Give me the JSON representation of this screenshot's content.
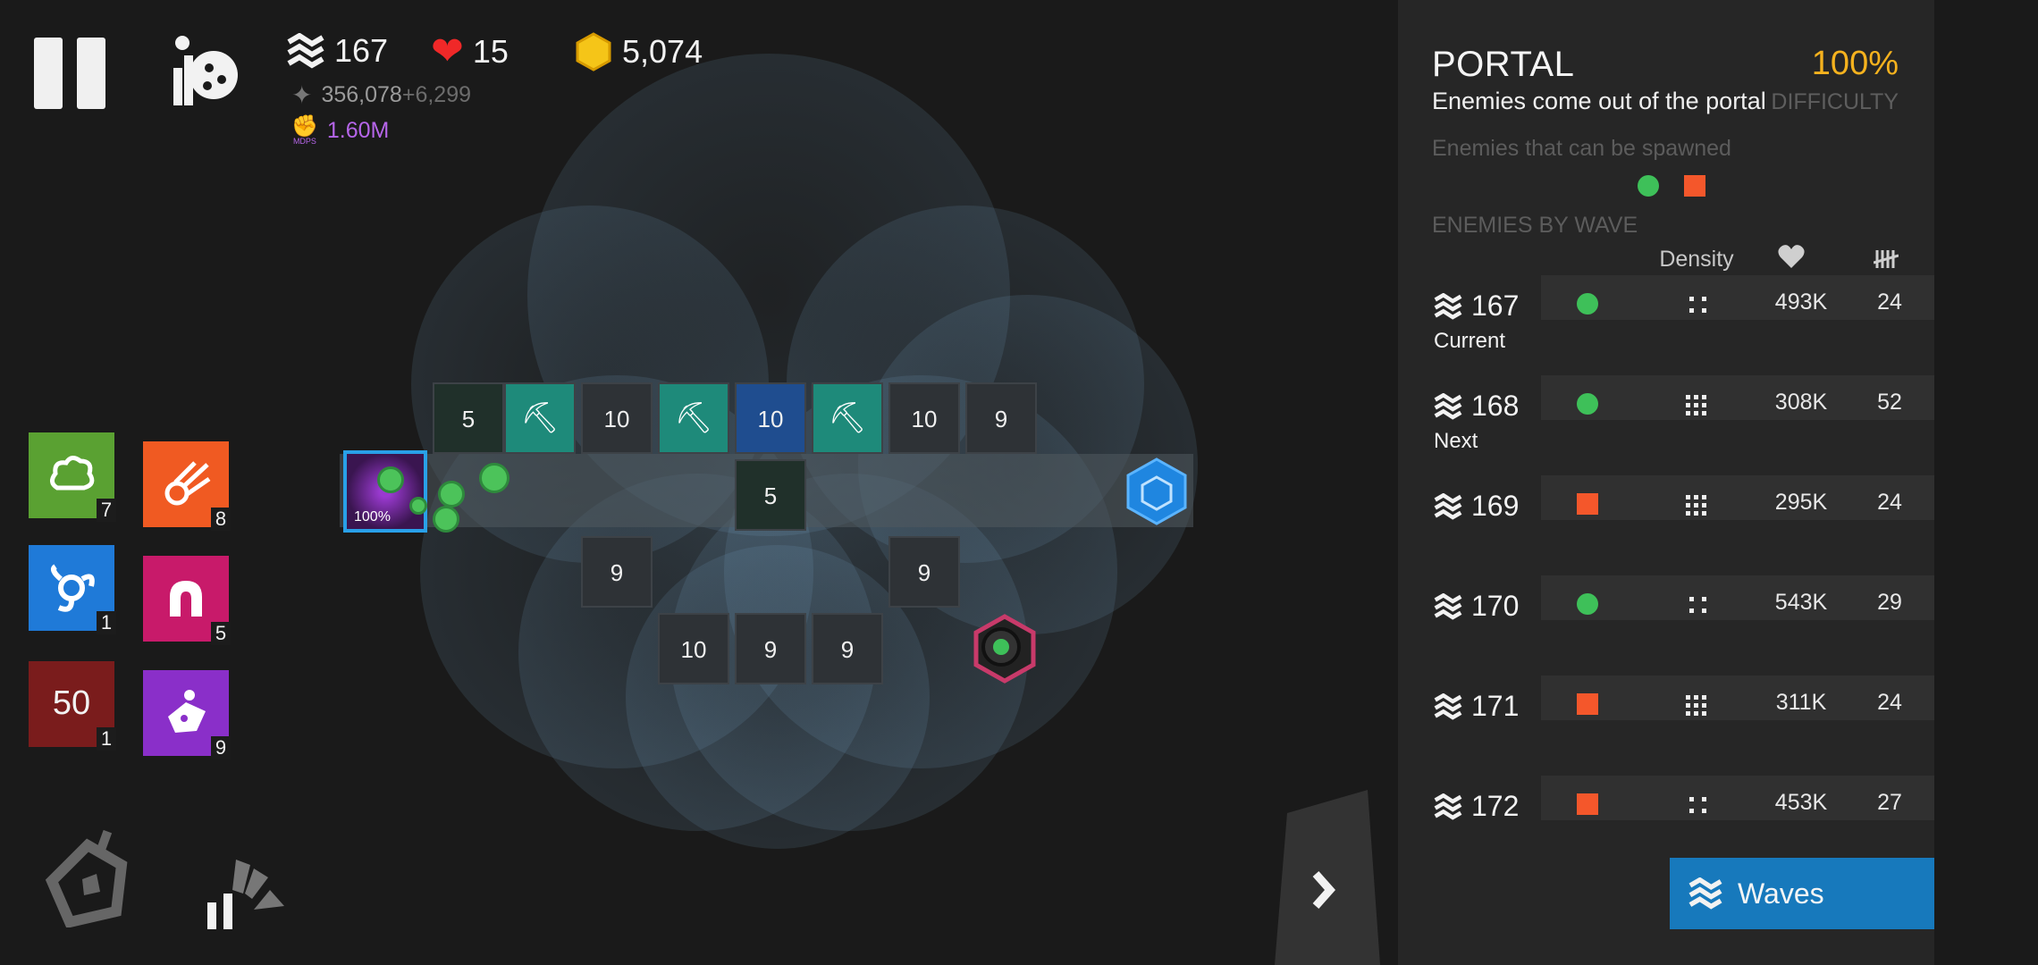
{
  "hud": {
    "wave": "167",
    "lives": "15",
    "coins": "5,074",
    "score": "356,078",
    "score_delta": "+6,299",
    "mdps_badge": "MDPS",
    "mdps": "1.60M"
  },
  "map": {
    "portal_percent": "100%",
    "towers": [
      "5",
      "10",
      "10",
      "10",
      "9",
      "5",
      "9",
      "9",
      "10",
      "9",
      "9"
    ]
  },
  "abilities": [
    {
      "icon": "bush-icon",
      "count": "7",
      "color": "#5aa132"
    },
    {
      "icon": "fireball-icon",
      "count": "8",
      "color": "#f05a22"
    },
    {
      "icon": "blizzard-icon",
      "count": "1",
      "color": "#1f7ad8"
    },
    {
      "icon": "magnet-icon",
      "count": "5",
      "color": "#c81a6a"
    },
    {
      "icon": "bomb-icon",
      "label": "50",
      "count": "1",
      "color": "#7a1c1c"
    },
    {
      "icon": "loot-icon",
      "count": "9",
      "color": "#8a2fc9"
    }
  ],
  "panel": {
    "title": "PORTAL",
    "subtitle": "Enemies come out of the portal",
    "difficulty_value": "100%",
    "difficulty_label": "DIFFICULTY",
    "spawnable_label": "Enemies that can be spawned",
    "waves_heading": "ENEMIES BY WAVE",
    "col_density": "Density",
    "waves": [
      {
        "wave": "167",
        "tag": "Current",
        "type": "circle",
        "density": "low",
        "hp": "493K",
        "count": "24"
      },
      {
        "wave": "168",
        "tag": "Next",
        "type": "circle",
        "density": "high",
        "hp": "308K",
        "count": "52"
      },
      {
        "wave": "169",
        "tag": "",
        "type": "square",
        "density": "high",
        "hp": "295K",
        "count": "24"
      },
      {
        "wave": "170",
        "tag": "",
        "type": "circle",
        "density": "low",
        "hp": "543K",
        "count": "29"
      },
      {
        "wave": "171",
        "tag": "",
        "type": "square",
        "density": "high",
        "hp": "311K",
        "count": "24"
      },
      {
        "wave": "172",
        "tag": "",
        "type": "square",
        "density": "low",
        "hp": "453K",
        "count": "27"
      }
    ],
    "waves_button": "Waves"
  },
  "colors": {
    "accent": "#1779bc",
    "difficulty": "#f5b21e",
    "enemy_circle": "#3ec059",
    "enemy_square": "#f4572b"
  }
}
